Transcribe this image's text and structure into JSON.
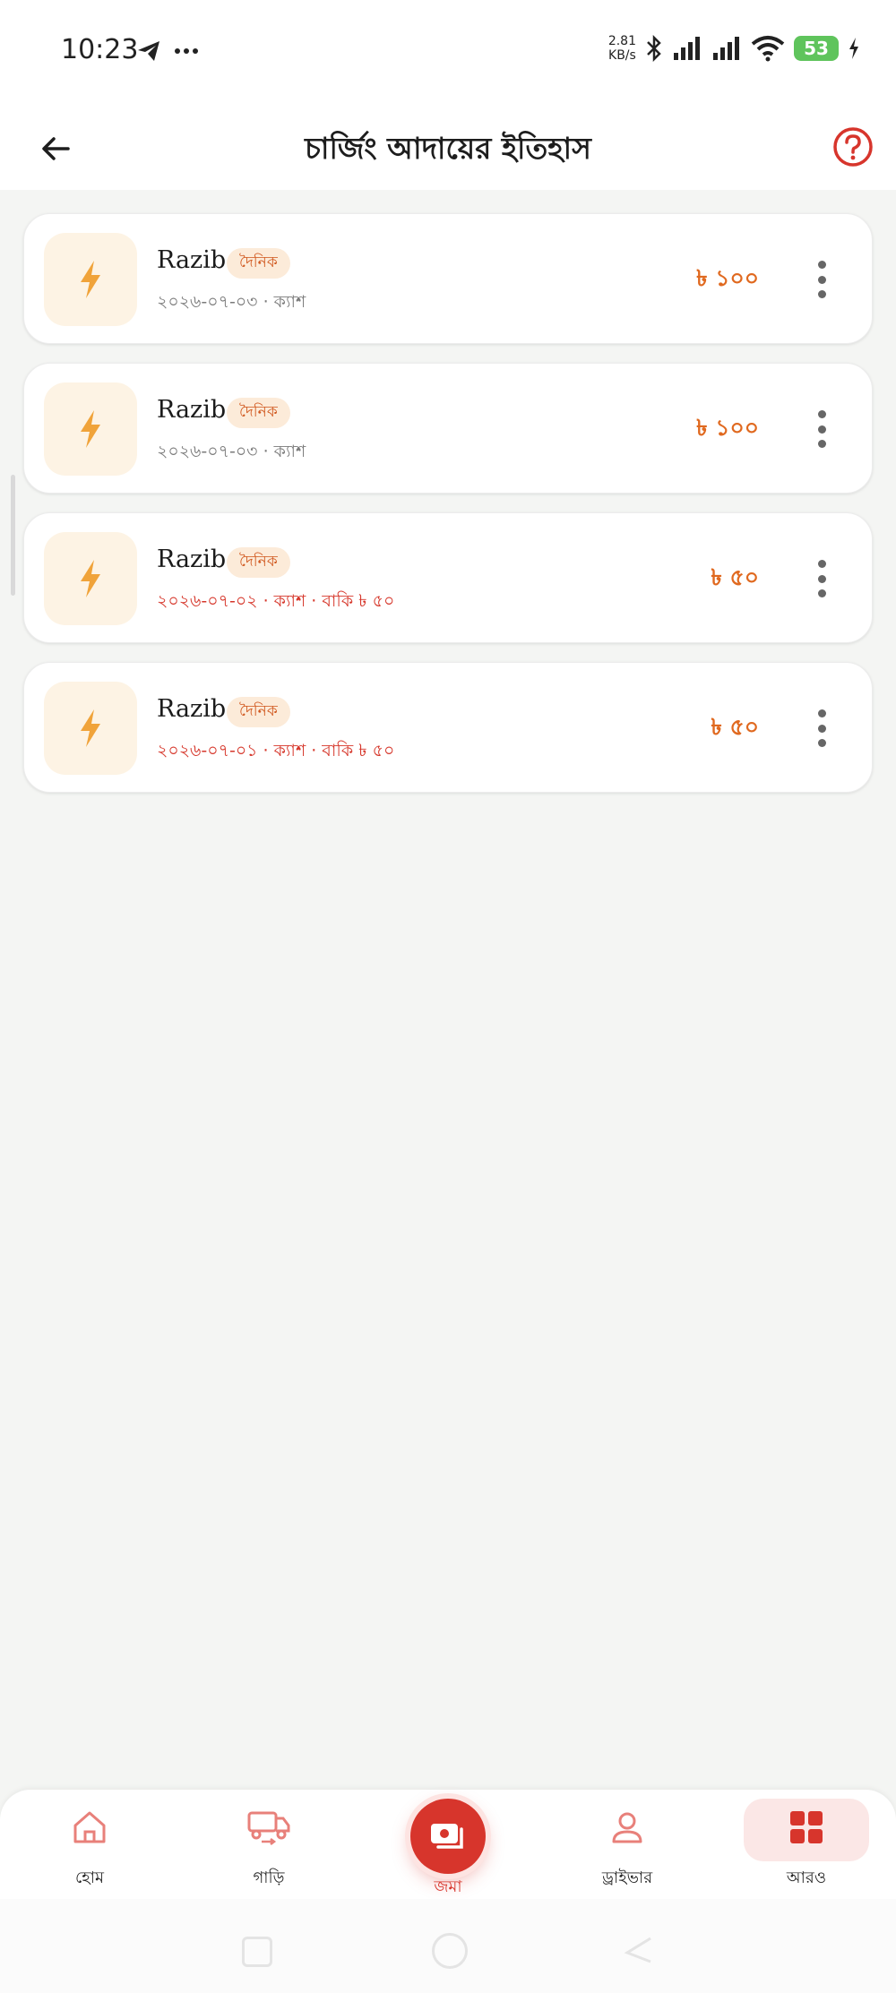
{
  "status_bar": {
    "time": "10:23",
    "net_speed_value": "2.81",
    "net_speed_unit": "KB/s",
    "battery": "53",
    "icons": [
      "telegram-icon",
      "more-dots-icon",
      "bluetooth-icon",
      "signal-icon",
      "signal-icon",
      "wifi-icon",
      "charging-icon"
    ]
  },
  "header": {
    "title": "চার্জিং আদায়ের ইতিহাস",
    "back_icon": "arrow-left-icon",
    "help_icon": "help-circle-icon"
  },
  "records": [
    {
      "name": "Razib",
      "badge": "দৈনিক",
      "details": "২০২৬-০৭-০৩ · ক্যাশ",
      "has_due": false,
      "amount": "৳ ১০০"
    },
    {
      "name": "Razib",
      "badge": "দৈনিক",
      "details": "২০২৬-০৭-০৩ · ক্যাশ",
      "has_due": false,
      "amount": "৳ ১০০"
    },
    {
      "name": "Razib",
      "badge": "দৈনিক",
      "details": "২০২৬-০৭-০২ · ক্যাশ · বাকি ৳ ৫০",
      "has_due": true,
      "amount": "৳ ৫০"
    },
    {
      "name": "Razib",
      "badge": "দৈনিক",
      "details": "২০২৬-০৭-০১ · ক্যাশ · বাকি ৳ ৫০",
      "has_due": true,
      "amount": "৳ ৫০"
    }
  ],
  "bottom_nav": {
    "items": [
      {
        "label": "হোম",
        "icon": "home-icon"
      },
      {
        "label": "গাড়ি",
        "icon": "vehicle-icon"
      },
      {
        "label": "জমা",
        "icon": "deposit-icon"
      },
      {
        "label": "ড্রাইভার",
        "icon": "driver-icon"
      },
      {
        "label": "আরও",
        "icon": "grid-icon"
      }
    ],
    "active": "আরও"
  },
  "colors": {
    "accent_orange": "#e0691f",
    "accent_red": "#d7352c",
    "icon_bolt": "#f0a33a",
    "badge_bg": "#fcebd9"
  }
}
